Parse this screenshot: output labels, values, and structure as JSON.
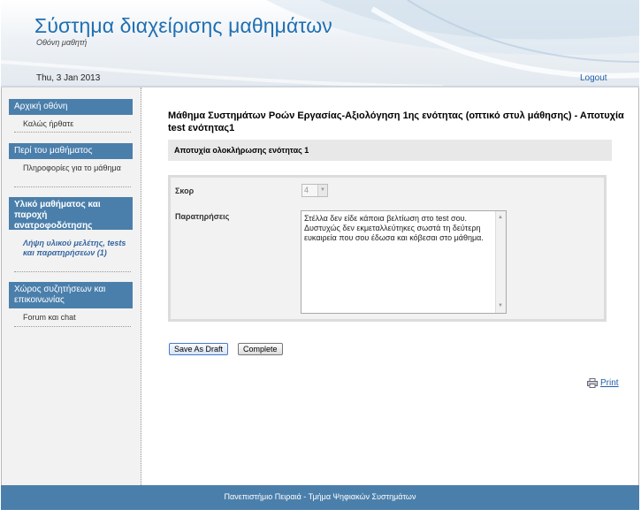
{
  "header": {
    "title": "Σύστημα διαχείρισης μαθημάτων",
    "subtitle": "Οθόνη μαθητή",
    "date": "Thu, 3 Jan 2013",
    "logout_label": "Logout"
  },
  "sidebar": {
    "sections": [
      {
        "heading": "Αρχική οθόνη",
        "items": [
          "Καλώς ήρθατε"
        ]
      },
      {
        "heading": "Περί του μαθήματος",
        "items": [
          "Πληροφορίες για το μάθημα"
        ]
      },
      {
        "heading": "Υλικό μαθήματος και παροχή ανατροφοδότησης",
        "items": [
          "Λήψη υλικού μελέτης, tests και παρατηρήσεων (1)"
        ]
      },
      {
        "heading": "Χώρος συζητήσεων και επικοινωνίας",
        "items": [
          "Forum και chat"
        ]
      }
    ]
  },
  "main": {
    "title": "Μάθημα Συστημάτων Ροών Εργασίας-Αξιολόγηση 1ης ενότητας (οπτικό στυλ μάθησης) - Αποτυχία test ενότητας1",
    "section_title": "Αποτυχία ολοκλήρωσης ενότητας 1",
    "score_label": "Σκορ",
    "score_value": "4",
    "remarks_label": "Παρατηρήσεις",
    "remarks_text": "Στέλλα δεν είδε κάποια βελτίωση στο test σου. Δυστυχώς δεν εκμεταλλεύτηκες σωστά τη δεύτερη ευκαιρεία που σου έδωσα και κόβεσαι στο μάθημα.",
    "save_draft_label": "Save As Draft",
    "complete_label": "Complete",
    "print_label": "Print"
  },
  "footer": {
    "text": "Πανεπιστήμιο Πειραιά - Τμήμα Ψηφιακών Συστημάτων"
  },
  "colors": {
    "accent": "#4b7fab",
    "title": "#1f6fb2",
    "link": "#1f5fa8"
  },
  "icons": {
    "print": "printer-icon",
    "select_arrow": "chevron-down-icon"
  }
}
